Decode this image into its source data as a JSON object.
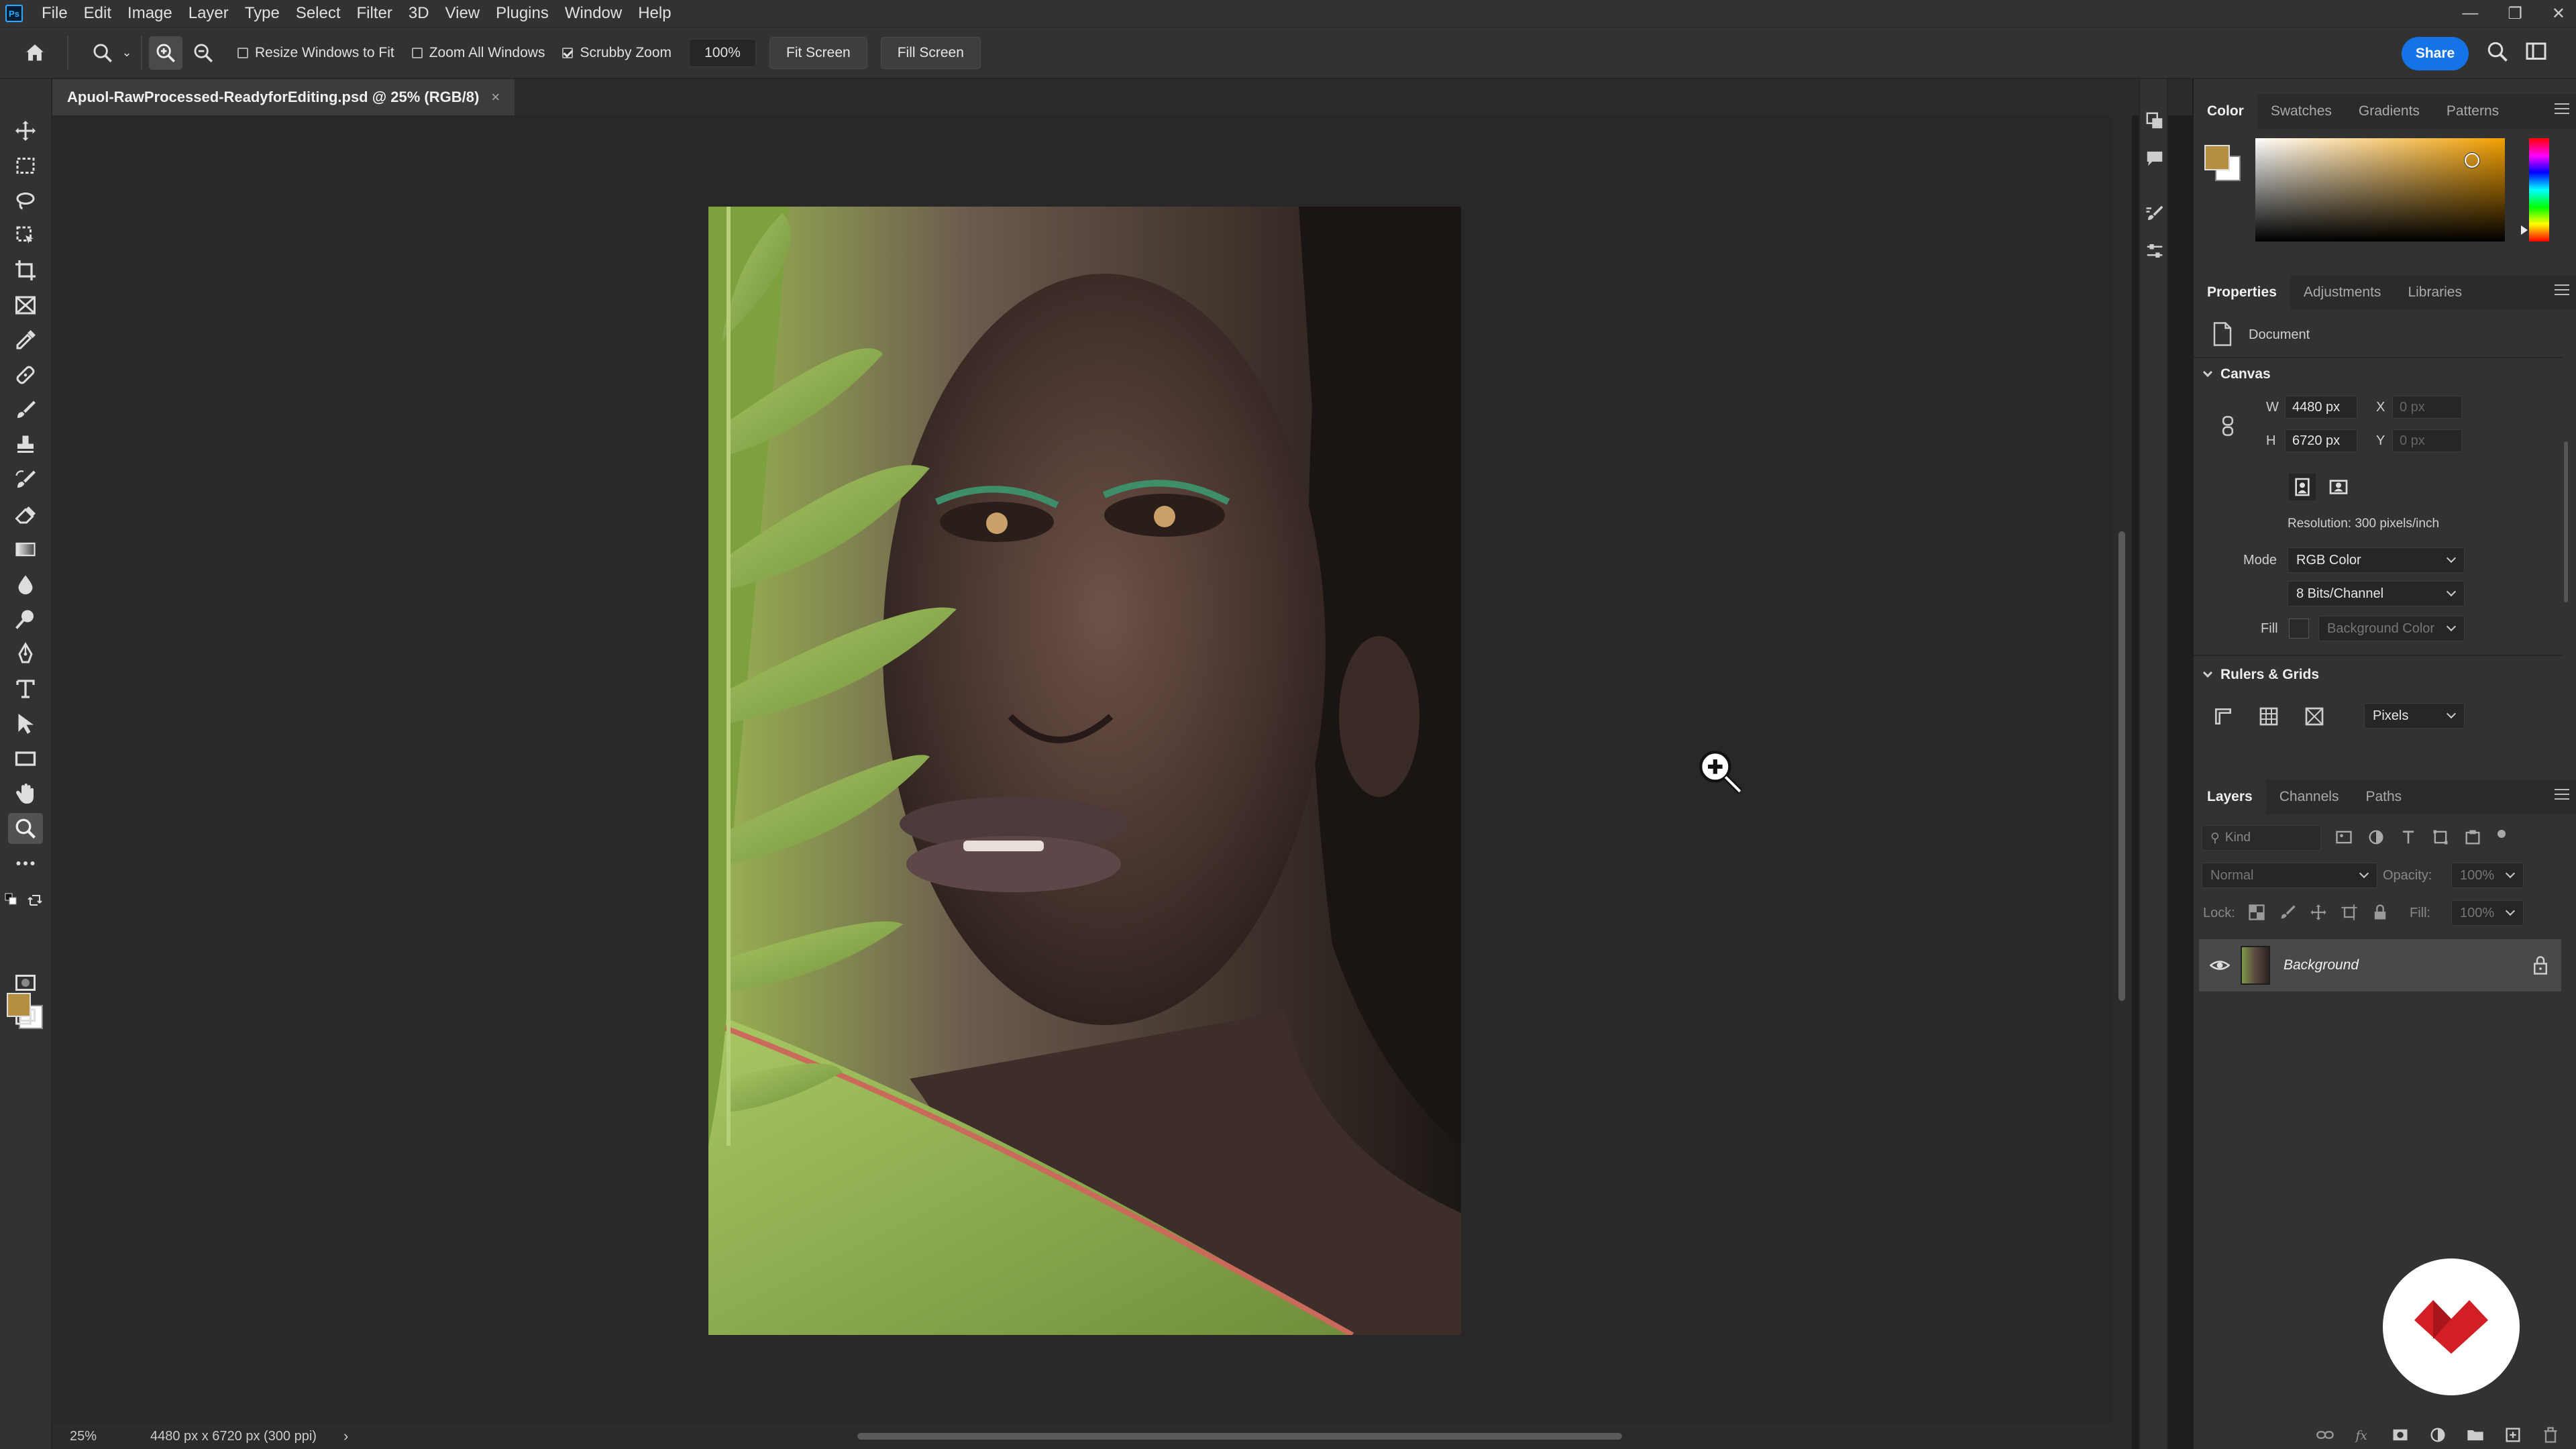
{
  "menubar": {
    "logo": "Ps",
    "items": [
      "File",
      "Edit",
      "Image",
      "Layer",
      "Type",
      "Select",
      "Filter",
      "3D",
      "View",
      "Plugins",
      "Window",
      "Help"
    ]
  },
  "options_bar": {
    "resize_windows": "Resize Windows to Fit",
    "zoom_all_windows": "Zoom All Windows",
    "scrubby_zoom": "Scrubby Zoom",
    "scrubby_zoom_checked": true,
    "zoom_value": "100%",
    "fit_screen": "Fit Screen",
    "fill_screen": "Fill Screen",
    "share": "Share"
  },
  "document": {
    "tab_title": "Apuol-RawProcessed-ReadyforEditing.psd @ 25% (RGB/8)",
    "close": "×"
  },
  "status_bar": {
    "zoom": "25%",
    "doc_info": "4480 px x 6720 px (300 ppi)",
    "arrow": "›"
  },
  "colors": {
    "foreground": "#b48f40",
    "background": "#ffffff",
    "accent": "#1473e6"
  },
  "color_panel": {
    "tabs": [
      "Color",
      "Swatches",
      "Gradients",
      "Patterns"
    ]
  },
  "properties_panel": {
    "tabs": [
      "Properties",
      "Adjustments",
      "Libraries"
    ],
    "document_label": "Document",
    "canvas": {
      "section": "Canvas",
      "w_label": "W",
      "w_value": "4480 px",
      "h_label": "H",
      "h_value": "6720 px",
      "x_label": "X",
      "x_value": "0 px",
      "y_label": "Y",
      "y_value": "0 px",
      "resolution": "Resolution: 300 pixels/inch",
      "mode_label": "Mode",
      "mode_value": "RGB Color",
      "bits_value": "8 Bits/Channel",
      "fill_label": "Fill",
      "fill_value": "Background Color"
    },
    "rulers_grids": {
      "section": "Rulers & Grids",
      "units": "Pixels"
    }
  },
  "layers_panel": {
    "tabs": [
      "Layers",
      "Channels",
      "Paths"
    ],
    "filter_kind": "Kind",
    "blend_mode": "Normal",
    "opacity_label": "Opacity:",
    "opacity_value": "100%",
    "lock_label": "Lock:",
    "fill_label": "Fill:",
    "fill_value": "100%",
    "layers": [
      {
        "name": "Background",
        "visible": true,
        "locked": true
      }
    ]
  },
  "icons": {
    "tools": [
      "move-icon",
      "marquee-icon",
      "lasso-icon",
      "object-select-icon",
      "crop-icon",
      "frame-icon",
      "eyedropper-icon",
      "healing-icon",
      "brush-icon",
      "stamp-icon",
      "history-brush-icon",
      "eraser-icon",
      "gradient-icon",
      "blur-icon",
      "dodge-icon",
      "pen-icon",
      "type-icon",
      "path-select-icon",
      "rectangle-icon",
      "hand-icon",
      "zoom-icon",
      "more-tools-icon"
    ]
  }
}
